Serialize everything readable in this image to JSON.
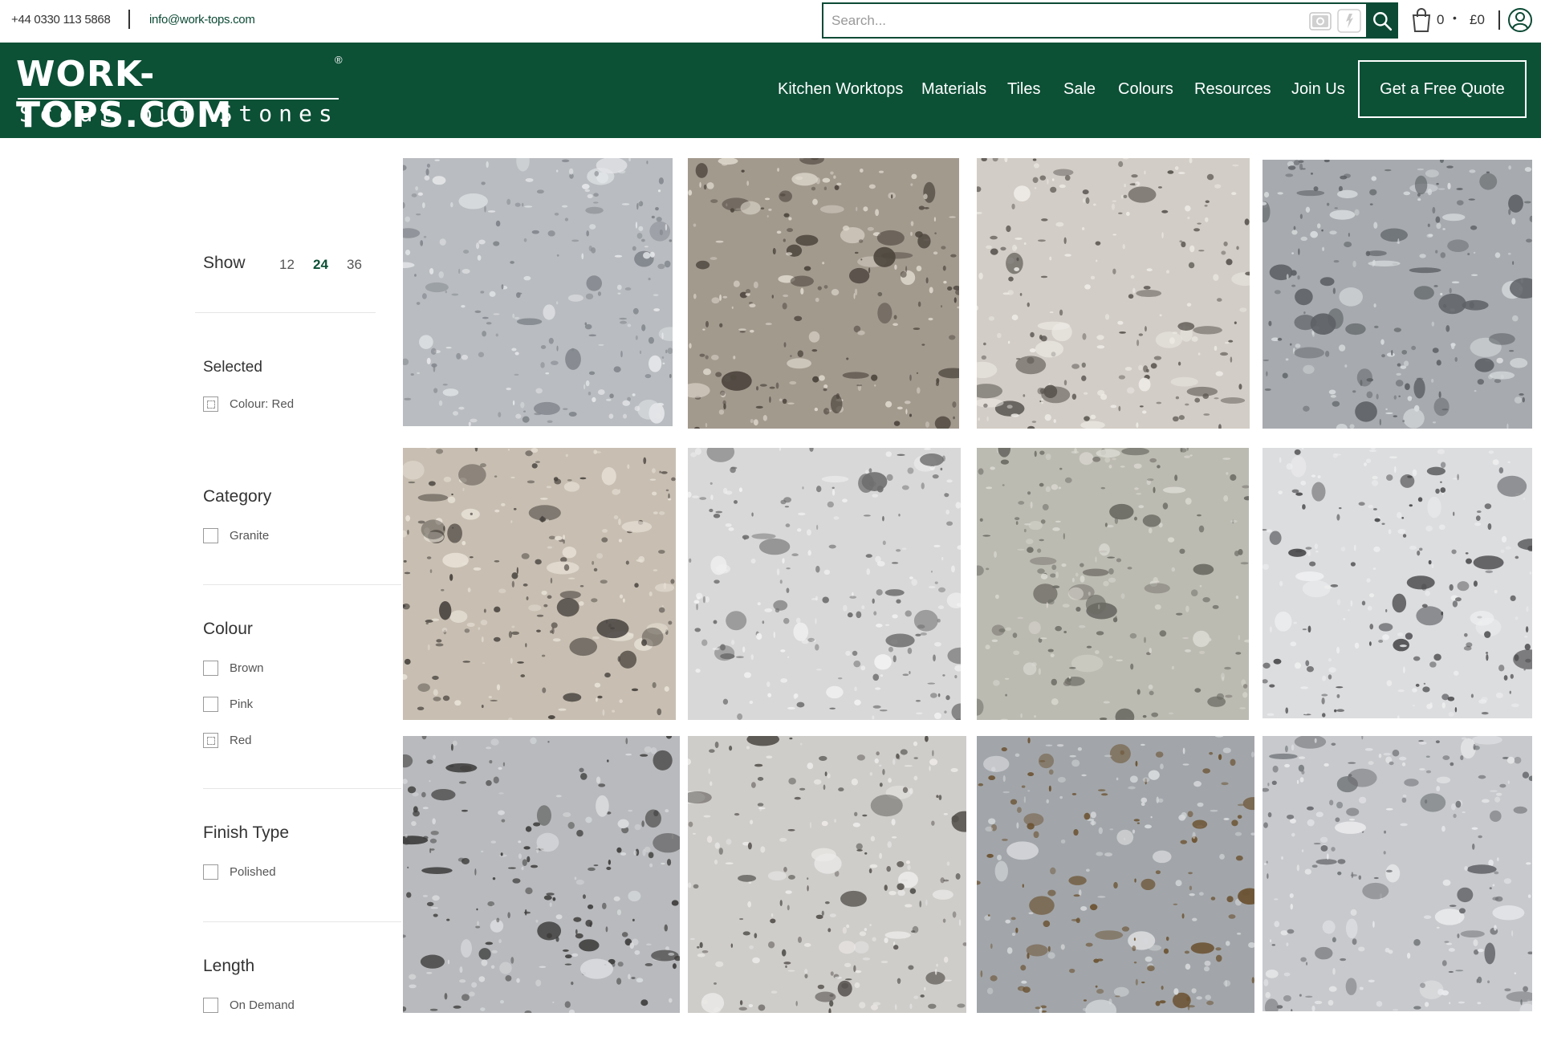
{
  "topbar": {
    "phone": "+44 0330 113 5868",
    "email": "info@work-tops.com"
  },
  "search": {
    "placeholder": "Search..."
  },
  "cart": {
    "count": "0",
    "dot": "•",
    "total": "£0"
  },
  "logo": {
    "main": "WORK-TOPS.COM",
    "registered": "®",
    "tagline": "Scout out Stones"
  },
  "nav": {
    "items": [
      "Kitchen Worktops",
      "Materials",
      "Tiles",
      "Sale",
      "Colours",
      "Resources",
      "Join Us"
    ],
    "quote_label": "Get a Free Quote"
  },
  "sidebar": {
    "show_label": "Show",
    "show_options": [
      "12",
      "24",
      "36"
    ],
    "show_active": "24",
    "selected": {
      "title": "Selected",
      "items": [
        "Colour: Red"
      ]
    },
    "category": {
      "title": "Category",
      "items": [
        "Granite"
      ]
    },
    "colour": {
      "title": "Colour",
      "items": [
        "Brown",
        "Pink",
        "Red"
      ]
    },
    "finish": {
      "title": "Finish Type",
      "items": [
        "Polished"
      ]
    },
    "length": {
      "title": "Length",
      "items": [
        "On Demand"
      ]
    }
  },
  "colors": {
    "brand_green": "#0c5036",
    "search_border": "#0c4a35"
  },
  "products": [
    {
      "name": "granite-tile-1",
      "base": "#b9bcc0",
      "fleck": "#7f848a",
      "fleck2": "#e4e6e8"
    },
    {
      "name": "granite-tile-2",
      "base": "#a39a8e",
      "fleck": "#4d463e",
      "fleck2": "#ddd6cb"
    },
    {
      "name": "granite-tile-3",
      "base": "#d2cdc6",
      "fleck": "#5a5550",
      "fleck2": "#eeebe6"
    },
    {
      "name": "granite-tile-4",
      "base": "#a7abaf",
      "fleck": "#5e6266",
      "fleck2": "#d9dcde"
    },
    {
      "name": "granite-tile-5",
      "base": "#c8bfb2",
      "fleck": "#4a4540",
      "fleck2": "#e8e1d6"
    },
    {
      "name": "granite-tile-6",
      "base": "#d8d8d8",
      "fleck": "#6e6e6e",
      "fleck2": "#f1f1f1"
    },
    {
      "name": "granite-tile-7",
      "base": "#bcbbb2",
      "fleck": "#6c6b64",
      "fleck2": "#d9d8d0"
    },
    {
      "name": "granite-tile-8",
      "base": "#dcdddf",
      "fleck": "#4b4b4e",
      "fleck2": "#eeeff0"
    },
    {
      "name": "granite-tile-9",
      "base": "#b8babd",
      "fleck": "#3e3d3c",
      "fleck2": "#dadcde"
    },
    {
      "name": "granite-tile-10",
      "base": "#cfcdca",
      "fleck": "#55524e",
      "fleck2": "#eceae8"
    },
    {
      "name": "granite-tile-11",
      "base": "#a2a6aa",
      "fleck": "#6b5231",
      "fleck2": "#d7d9db"
    },
    {
      "name": "granite-tile-12",
      "base": "#c7c9cc",
      "fleck": "#6a6c70",
      "fleck2": "#e9eaec"
    }
  ]
}
